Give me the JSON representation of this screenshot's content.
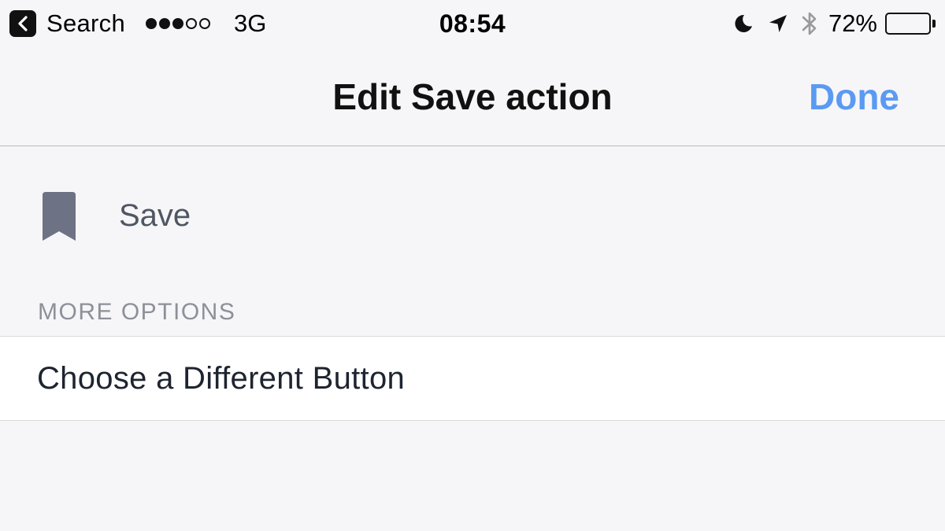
{
  "status_bar": {
    "back_label": "Search",
    "back_icon": "chevron-left-icon",
    "signal_bars_filled": 3,
    "signal_bars_total": 5,
    "network": "3G",
    "time": "08:54",
    "icons": [
      "moon-icon",
      "location-arrow-icon",
      "bluetooth-icon"
    ],
    "battery_percent": "72%",
    "battery_level": 0.72
  },
  "nav_bar": {
    "title": "Edit Save action",
    "done_label": "Done",
    "accent_color": "#5b9af2"
  },
  "action": {
    "icon": "bookmark-icon",
    "label": "Save",
    "icon_color": "#6d7384"
  },
  "more_options": {
    "header": "MORE OPTIONS",
    "items": [
      {
        "label": "Choose a Different Button"
      }
    ]
  }
}
